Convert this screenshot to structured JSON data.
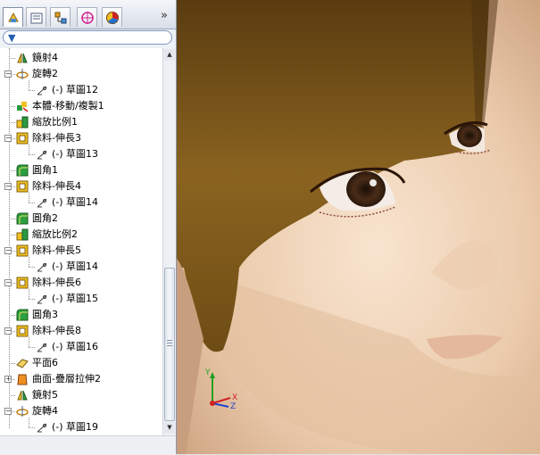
{
  "panel": {
    "tabs": [
      {
        "icon": "feature-manager-icon",
        "active": true
      },
      {
        "icon": "property-manager-icon",
        "active": false
      },
      {
        "icon": "configuration-manager-icon",
        "active": false
      },
      {
        "icon": "dimxpert-icon",
        "active": false
      },
      {
        "icon": "display-manager-icon",
        "active": false
      }
    ],
    "more": "»"
  },
  "tree": {
    "items": [
      {
        "label": "鏡射4",
        "icon": "mirror-icon",
        "level": 1
      },
      {
        "label": "旋轉2",
        "icon": "revolve-icon",
        "level": 1,
        "expanded": true
      },
      {
        "label": "(-) 草圖12",
        "icon": "sketch-icon",
        "level": 2
      },
      {
        "label": "本體-移動/複製1",
        "icon": "move-copy-body-icon",
        "level": 1
      },
      {
        "label": "縮放比例1",
        "icon": "scale-icon",
        "level": 1
      },
      {
        "label": "除料-伸長3",
        "icon": "extruded-cut-icon",
        "level": 1,
        "expanded": true
      },
      {
        "label": "(-) 草圖13",
        "icon": "sketch-icon",
        "level": 2
      },
      {
        "label": "圓角1",
        "icon": "fillet-icon",
        "level": 1
      },
      {
        "label": "除料-伸長4",
        "icon": "extruded-cut-icon",
        "level": 1,
        "expanded": true
      },
      {
        "label": "(-) 草圖14",
        "icon": "sketch-icon",
        "level": 2
      },
      {
        "label": "圓角2",
        "icon": "fillet-icon",
        "level": 1
      },
      {
        "label": "縮放比例2",
        "icon": "scale-icon",
        "level": 1
      },
      {
        "label": "除料-伸長5",
        "icon": "extruded-cut-icon",
        "level": 1,
        "expanded": true
      },
      {
        "label": "(-) 草圖14",
        "icon": "sketch-icon",
        "level": 2
      },
      {
        "label": "除料-伸長6",
        "icon": "extruded-cut-icon",
        "level": 1,
        "expanded": true
      },
      {
        "label": "(-) 草圖15",
        "icon": "sketch-icon",
        "level": 2
      },
      {
        "label": "圓角3",
        "icon": "fillet-icon",
        "level": 1
      },
      {
        "label": "除料-伸長8",
        "icon": "extruded-cut-icon",
        "level": 1,
        "expanded": true
      },
      {
        "label": "(-) 草圖16",
        "icon": "sketch-icon",
        "level": 2
      },
      {
        "label": "平面6",
        "icon": "plane-icon",
        "level": 1
      },
      {
        "label": "曲面-疊層拉伸2",
        "icon": "loft-surface-icon",
        "level": 1,
        "expanded": false
      },
      {
        "label": "鏡射5",
        "icon": "mirror-icon",
        "level": 1
      },
      {
        "label": "旋轉4",
        "icon": "revolve-icon",
        "level": 1,
        "expanded": true
      },
      {
        "label": "(-) 草圖19",
        "icon": "sketch-icon",
        "level": 2
      }
    ]
  },
  "triad": {
    "x_label": "X",
    "y_label": "Y",
    "z_label": "Z"
  },
  "colors": {
    "hair": "#8a6320",
    "skin": "#e9cdb0",
    "panel_bg": "#eef1f6",
    "tree_bg": "#ffffff"
  }
}
